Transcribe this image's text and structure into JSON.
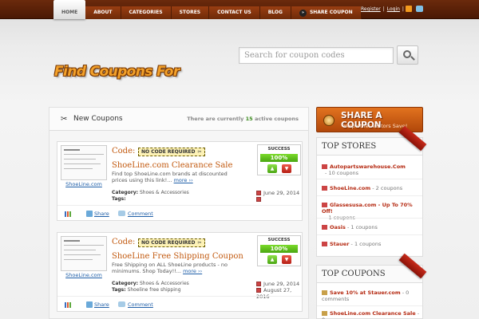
{
  "nav": {
    "items": [
      "HOME",
      "ABOUT",
      "CATEGORIES",
      "STORES",
      "CONTACT US",
      "BLOG",
      "SHARE COUPON"
    ],
    "share_icon_glyph": "»"
  },
  "toplinks": {
    "register": "Register",
    "sep": "|",
    "login": "Login",
    "sep2": "|"
  },
  "logo": {
    "text": "Find Coupons For"
  },
  "search": {
    "placeholder": "Search for coupon codes"
  },
  "main": {
    "title": "New Coupons",
    "active_prefix": "There are currently",
    "active_count": "15",
    "active_suffix": "active coupons",
    "coupons": [
      {
        "store": "ShoeLine.com",
        "code_label": "Code:",
        "code_value": "NO CODE REQUIRED",
        "title": "ShoeLine.com Clearance Sale",
        "desc": "Find top ShoeLine.com brands at discounted prices using this link!...",
        "more": "more ››",
        "category_label": "Category:",
        "category": "Shoes & Accessories",
        "tags_label": "Tags:",
        "tags": "",
        "date": "June 29, 2014",
        "expires": "",
        "success_label": "SUCCESS",
        "success_value": "100%",
        "success_percent": 100,
        "share": "Share",
        "comment": "Comment"
      },
      {
        "store": "ShoeLine.com",
        "code_label": "Code:",
        "code_value": "NO CODE REQUIRED",
        "title": "ShoeLine Free Shipping Coupon",
        "desc": "Free Shipping on ALL ShoeLine products - no minimums. Shop Today!!...",
        "more": "more ››",
        "category_label": "Category:",
        "category": "Shoes & Accessories",
        "tags_label": "Tags:",
        "tags": "Shoeline free shipping",
        "date": "June 29, 2014",
        "expires": "August 27, 2016",
        "success_label": "SUCCESS",
        "success_value": "100%",
        "success_percent": 100,
        "share": "Share",
        "comment": "Comment"
      }
    ]
  },
  "sidebar": {
    "share_button": {
      "title": "SHARE A COUPON",
      "subtitle": "Help other visitors Save!"
    },
    "top_stores": {
      "title": "TOP STORES",
      "items": [
        {
          "name": "Autopartswarehouse.Com",
          "meta": "10 coupons",
          "sep": "-"
        },
        {
          "name": "ShoeLine.com",
          "meta": "2 coupons",
          "sep": "-"
        },
        {
          "name": "Glassesusa.com - Up To 70% Off!",
          "meta": "1 coupons",
          "sep": "-"
        },
        {
          "name": "Oasis",
          "meta": "1 coupons",
          "sep": "-"
        },
        {
          "name": "Stauer",
          "meta": "1 coupons",
          "sep": "-"
        }
      ]
    },
    "top_coupons": {
      "title": "TOP COUPONS",
      "items": [
        {
          "name": "Save 10% at Stauer.com",
          "meta": "0 comments",
          "sep": "-"
        },
        {
          "name": "ShoeLine.com Clearance Sale",
          "meta": "0",
          "sep": "-"
        }
      ]
    }
  }
}
